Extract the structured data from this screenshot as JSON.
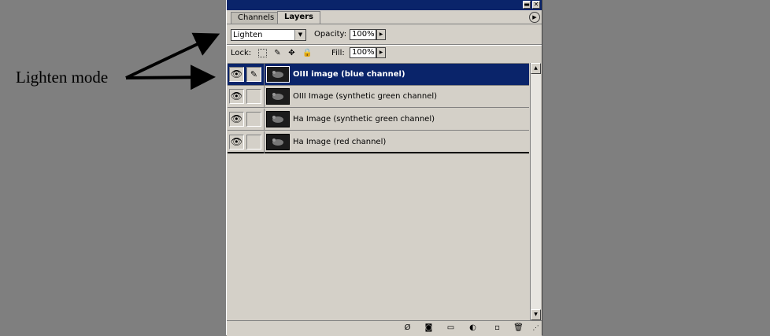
{
  "annotation": {
    "text": "Lighten mode"
  },
  "titlebar": {
    "minimize_icon": "minimize-icon",
    "close_icon": "close-icon"
  },
  "tabs": [
    {
      "label": "Channels",
      "active": false
    },
    {
      "label": "Layers",
      "active": true
    }
  ],
  "options": {
    "blend_mode": "Lighten",
    "opacity_label": "Opacity:",
    "opacity_value": "100%",
    "lock_label": "Lock:",
    "fill_label": "Fill:",
    "fill_value": "100%"
  },
  "layers": [
    {
      "name": "OIII image (blue channel)",
      "selected": true,
      "visible": true,
      "brush": true
    },
    {
      "name": "OIII Image (synthetic green channel)",
      "selected": false,
      "visible": true,
      "brush": false
    },
    {
      "name": "Ha Image (synthetic green channel)",
      "selected": false,
      "visible": true,
      "brush": false
    },
    {
      "name": "Ha Image (red channel)",
      "selected": false,
      "visible": true,
      "brush": false
    }
  ],
  "bottom_icons": [
    "layer-style-icon",
    "layer-mask-icon",
    "new-group-icon",
    "adjustment-layer-icon",
    "new-layer-icon",
    "delete-layer-icon"
  ],
  "colors": {
    "selection": "#0a246a",
    "panel": "#d4d0c8",
    "background": "#7f7f7f"
  }
}
